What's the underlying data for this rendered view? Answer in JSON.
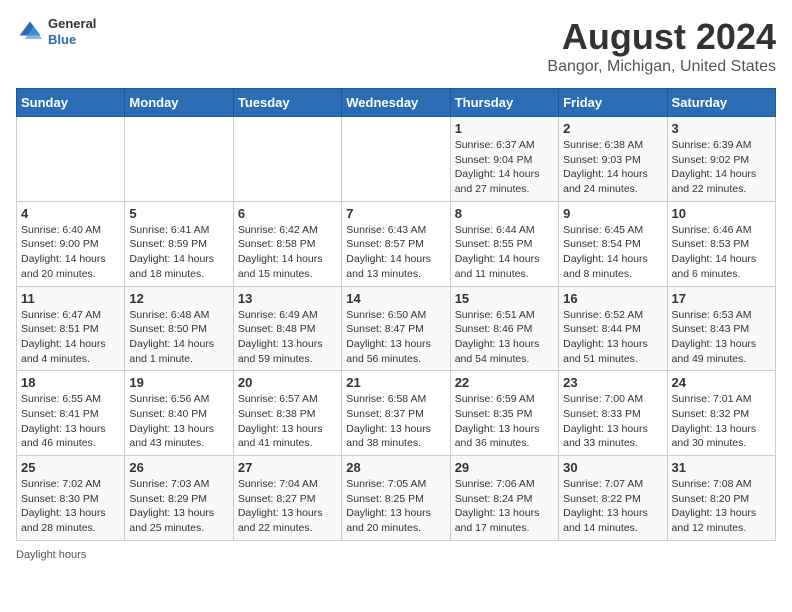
{
  "header": {
    "logo_general": "General",
    "logo_blue": "Blue",
    "title": "August 2024",
    "subtitle": "Bangor, Michigan, United States"
  },
  "weekdays": [
    "Sunday",
    "Monday",
    "Tuesday",
    "Wednesday",
    "Thursday",
    "Friday",
    "Saturday"
  ],
  "weeks": [
    [
      {
        "day": "",
        "info": ""
      },
      {
        "day": "",
        "info": ""
      },
      {
        "day": "",
        "info": ""
      },
      {
        "day": "",
        "info": ""
      },
      {
        "day": "1",
        "sunrise": "Sunrise: 6:37 AM",
        "sunset": "Sunset: 9:04 PM",
        "daylight": "Daylight: 14 hours and 27 minutes."
      },
      {
        "day": "2",
        "sunrise": "Sunrise: 6:38 AM",
        "sunset": "Sunset: 9:03 PM",
        "daylight": "Daylight: 14 hours and 24 minutes."
      },
      {
        "day": "3",
        "sunrise": "Sunrise: 6:39 AM",
        "sunset": "Sunset: 9:02 PM",
        "daylight": "Daylight: 14 hours and 22 minutes."
      }
    ],
    [
      {
        "day": "4",
        "sunrise": "Sunrise: 6:40 AM",
        "sunset": "Sunset: 9:00 PM",
        "daylight": "Daylight: 14 hours and 20 minutes."
      },
      {
        "day": "5",
        "sunrise": "Sunrise: 6:41 AM",
        "sunset": "Sunset: 8:59 PM",
        "daylight": "Daylight: 14 hours and 18 minutes."
      },
      {
        "day": "6",
        "sunrise": "Sunrise: 6:42 AM",
        "sunset": "Sunset: 8:58 PM",
        "daylight": "Daylight: 14 hours and 15 minutes."
      },
      {
        "day": "7",
        "sunrise": "Sunrise: 6:43 AM",
        "sunset": "Sunset: 8:57 PM",
        "daylight": "Daylight: 14 hours and 13 minutes."
      },
      {
        "day": "8",
        "sunrise": "Sunrise: 6:44 AM",
        "sunset": "Sunset: 8:55 PM",
        "daylight": "Daylight: 14 hours and 11 minutes."
      },
      {
        "day": "9",
        "sunrise": "Sunrise: 6:45 AM",
        "sunset": "Sunset: 8:54 PM",
        "daylight": "Daylight: 14 hours and 8 minutes."
      },
      {
        "day": "10",
        "sunrise": "Sunrise: 6:46 AM",
        "sunset": "Sunset: 8:53 PM",
        "daylight": "Daylight: 14 hours and 6 minutes."
      }
    ],
    [
      {
        "day": "11",
        "sunrise": "Sunrise: 6:47 AM",
        "sunset": "Sunset: 8:51 PM",
        "daylight": "Daylight: 14 hours and 4 minutes."
      },
      {
        "day": "12",
        "sunrise": "Sunrise: 6:48 AM",
        "sunset": "Sunset: 8:50 PM",
        "daylight": "Daylight: 14 hours and 1 minute."
      },
      {
        "day": "13",
        "sunrise": "Sunrise: 6:49 AM",
        "sunset": "Sunset: 8:48 PM",
        "daylight": "Daylight: 13 hours and 59 minutes."
      },
      {
        "day": "14",
        "sunrise": "Sunrise: 6:50 AM",
        "sunset": "Sunset: 8:47 PM",
        "daylight": "Daylight: 13 hours and 56 minutes."
      },
      {
        "day": "15",
        "sunrise": "Sunrise: 6:51 AM",
        "sunset": "Sunset: 8:46 PM",
        "daylight": "Daylight: 13 hours and 54 minutes."
      },
      {
        "day": "16",
        "sunrise": "Sunrise: 6:52 AM",
        "sunset": "Sunset: 8:44 PM",
        "daylight": "Daylight: 13 hours and 51 minutes."
      },
      {
        "day": "17",
        "sunrise": "Sunrise: 6:53 AM",
        "sunset": "Sunset: 8:43 PM",
        "daylight": "Daylight: 13 hours and 49 minutes."
      }
    ],
    [
      {
        "day": "18",
        "sunrise": "Sunrise: 6:55 AM",
        "sunset": "Sunset: 8:41 PM",
        "daylight": "Daylight: 13 hours and 46 minutes."
      },
      {
        "day": "19",
        "sunrise": "Sunrise: 6:56 AM",
        "sunset": "Sunset: 8:40 PM",
        "daylight": "Daylight: 13 hours and 43 minutes."
      },
      {
        "day": "20",
        "sunrise": "Sunrise: 6:57 AM",
        "sunset": "Sunset: 8:38 PM",
        "daylight": "Daylight: 13 hours and 41 minutes."
      },
      {
        "day": "21",
        "sunrise": "Sunrise: 6:58 AM",
        "sunset": "Sunset: 8:37 PM",
        "daylight": "Daylight: 13 hours and 38 minutes."
      },
      {
        "day": "22",
        "sunrise": "Sunrise: 6:59 AM",
        "sunset": "Sunset: 8:35 PM",
        "daylight": "Daylight: 13 hours and 36 minutes."
      },
      {
        "day": "23",
        "sunrise": "Sunrise: 7:00 AM",
        "sunset": "Sunset: 8:33 PM",
        "daylight": "Daylight: 13 hours and 33 minutes."
      },
      {
        "day": "24",
        "sunrise": "Sunrise: 7:01 AM",
        "sunset": "Sunset: 8:32 PM",
        "daylight": "Daylight: 13 hours and 30 minutes."
      }
    ],
    [
      {
        "day": "25",
        "sunrise": "Sunrise: 7:02 AM",
        "sunset": "Sunset: 8:30 PM",
        "daylight": "Daylight: 13 hours and 28 minutes."
      },
      {
        "day": "26",
        "sunrise": "Sunrise: 7:03 AM",
        "sunset": "Sunset: 8:29 PM",
        "daylight": "Daylight: 13 hours and 25 minutes."
      },
      {
        "day": "27",
        "sunrise": "Sunrise: 7:04 AM",
        "sunset": "Sunset: 8:27 PM",
        "daylight": "Daylight: 13 hours and 22 minutes."
      },
      {
        "day": "28",
        "sunrise": "Sunrise: 7:05 AM",
        "sunset": "Sunset: 8:25 PM",
        "daylight": "Daylight: 13 hours and 20 minutes."
      },
      {
        "day": "29",
        "sunrise": "Sunrise: 7:06 AM",
        "sunset": "Sunset: 8:24 PM",
        "daylight": "Daylight: 13 hours and 17 minutes."
      },
      {
        "day": "30",
        "sunrise": "Sunrise: 7:07 AM",
        "sunset": "Sunset: 8:22 PM",
        "daylight": "Daylight: 13 hours and 14 minutes."
      },
      {
        "day": "31",
        "sunrise": "Sunrise: 7:08 AM",
        "sunset": "Sunset: 8:20 PM",
        "daylight": "Daylight: 13 hours and 12 minutes."
      }
    ]
  ],
  "footer": {
    "daylight_label": "Daylight hours"
  }
}
